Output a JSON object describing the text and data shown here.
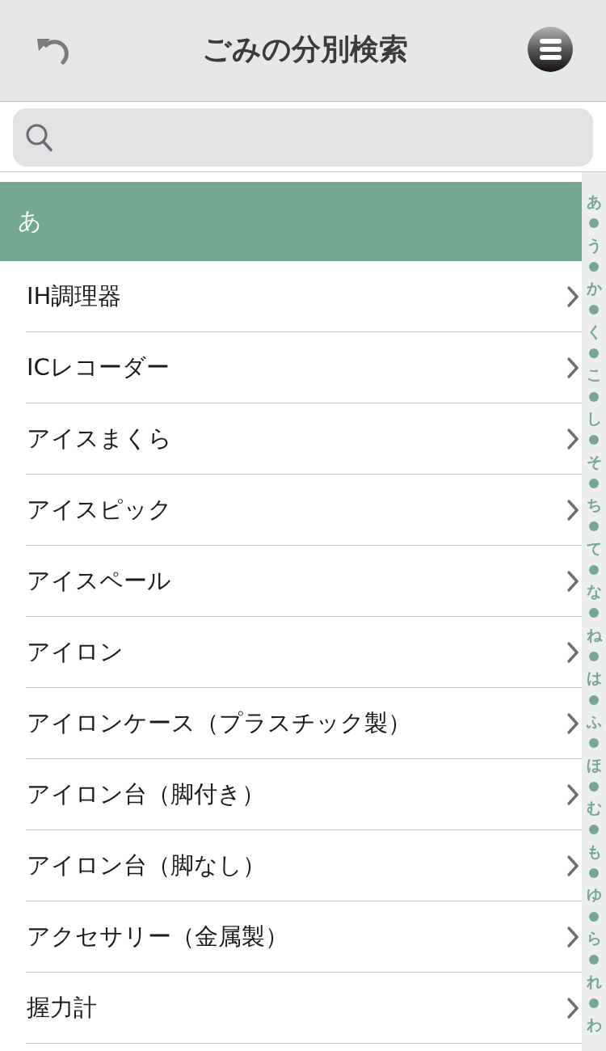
{
  "header": {
    "title": "ごみの分別検索"
  },
  "sections": [
    {
      "heading": "あ",
      "items": [
        "IH調理器",
        "ICレコーダー",
        "アイスまくら",
        "アイスピック",
        "アイスペール",
        "アイロン",
        "アイロンケース（プラスチック製）",
        "アイロン台（脚付き）",
        "アイロン台（脚なし）",
        "アクセサリー（金属製）",
        "握力計"
      ]
    }
  ],
  "index": [
    "あ",
    "う",
    "か",
    "く",
    "こ",
    "し",
    "そ",
    "ち",
    "て",
    "な",
    "ね",
    "は",
    "ふ",
    "ほ",
    "む",
    "も",
    "ゆ",
    "ら",
    "れ",
    "わ"
  ]
}
